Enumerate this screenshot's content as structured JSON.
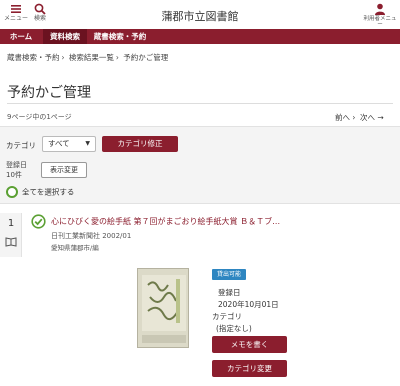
{
  "header": {
    "title": "蒲郡市立図書館",
    "menu_label": "メニュー",
    "search_label": "検索",
    "user_label": "利用者メニュー",
    "menu_icon": "hamburger-icon",
    "search_icon": "search-icon",
    "user_icon": "user-icon"
  },
  "nav": {
    "items": [
      {
        "label": "ホーム"
      },
      {
        "label": "資料検索"
      },
      {
        "label": "蔵書検索・予約"
      }
    ]
  },
  "breadcrumb": [
    "蔵書検索・予約",
    "検索結果一覧",
    "予約かご管理"
  ],
  "page_title": "予約かご管理",
  "pager": {
    "info": "9ページ中の1ページ",
    "prev": "前へ",
    "next": "次へ"
  },
  "filter": {
    "category_label": "カテゴリ",
    "category_value": "すべて",
    "category_button": "カテゴリ修正",
    "sort_label_1": "登録日",
    "sort_label_2": "10件",
    "view_button": "表示変更",
    "select_all": "全てを選択する"
  },
  "item": {
    "number": "1",
    "title": "心にひびく愛の絵手紙 第７回がまごおり絵手紙大賞 Ｂ＆Ｔブ…",
    "publisher": "日刊工業新聞社 2002/01",
    "library": "愛知県蒲郡市/編",
    "status_badge": "貸出可能",
    "reg_label": "登録日",
    "reg_date": "2020年10月01日",
    "cat_label": "カテゴリ",
    "cat_value": "(指定なし)",
    "memo_button": "メモを書く",
    "cat_change_button": "カテゴリ変更"
  },
  "colors": {
    "brand": "#8b1e2e",
    "check": "#5ba033",
    "badge": "#2e86c1"
  }
}
